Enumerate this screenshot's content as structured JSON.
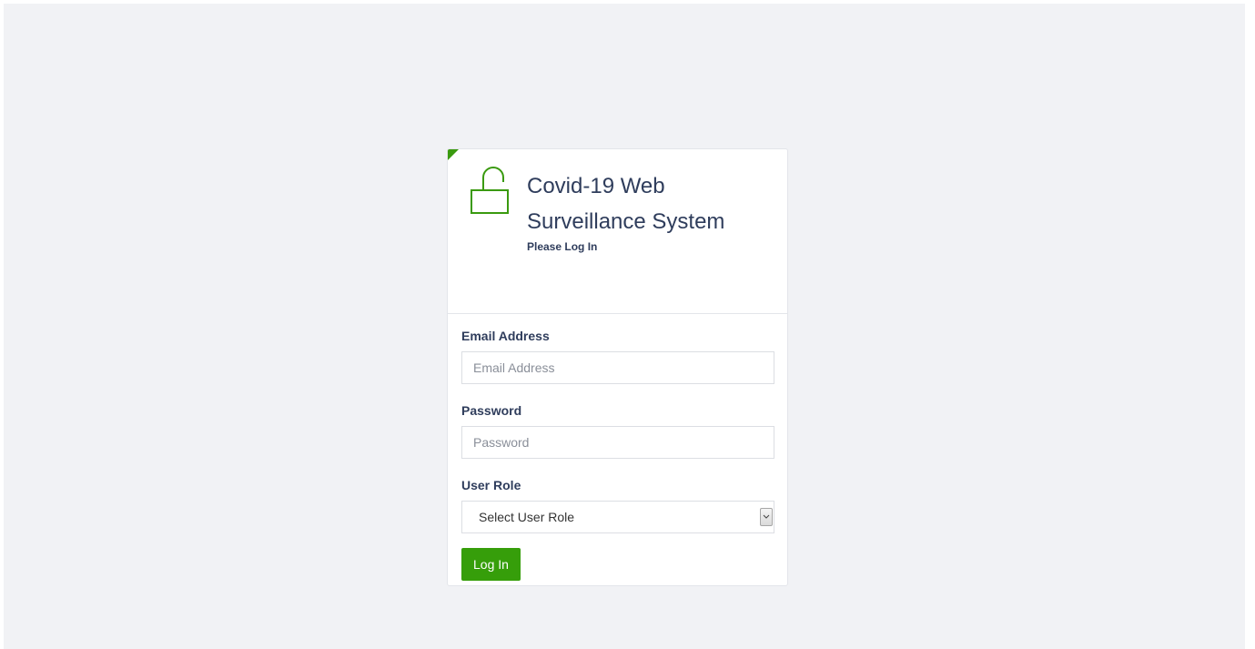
{
  "app": {
    "title": "Covid-19 Web Surveillance System",
    "subtitle": "Please Log In",
    "header_icon": "lock-open-icon"
  },
  "form": {
    "email": {
      "label": "Email Address",
      "placeholder": "Email Address",
      "value": ""
    },
    "password": {
      "label": "Password",
      "placeholder": "Password",
      "value": ""
    },
    "role": {
      "label": "User Role",
      "selected": "Select User Role",
      "arrow_icon": "chevron-down-icon"
    },
    "submit_label": "Log In"
  },
  "colors": {
    "accent": "#369e0a",
    "heading_text": "#2f3d5c",
    "page_background": "#f1f2f5"
  }
}
